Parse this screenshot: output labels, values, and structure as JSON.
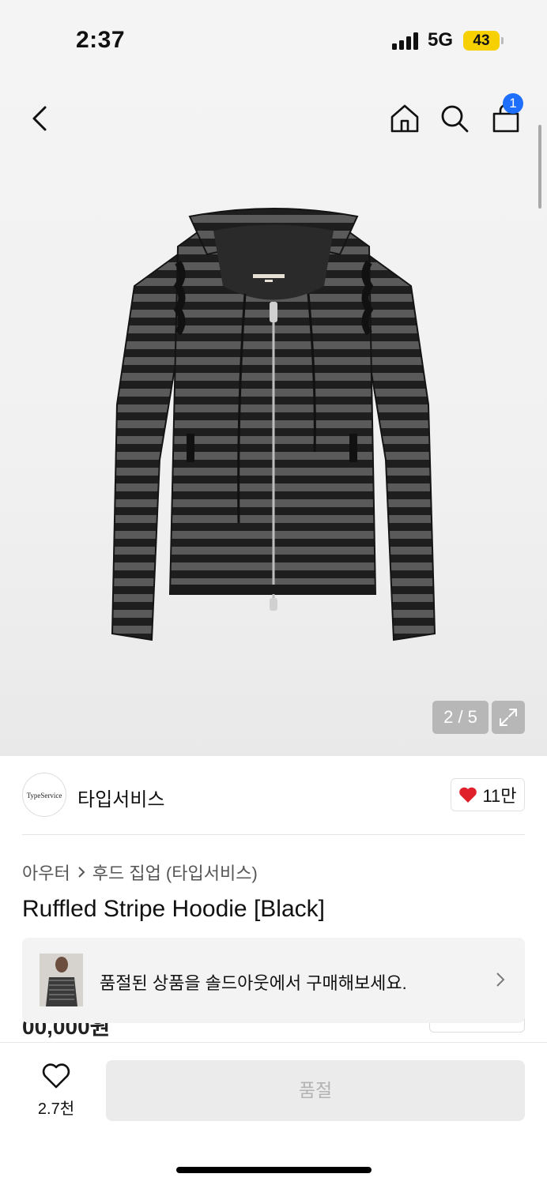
{
  "status_bar": {
    "time": "2:37",
    "network": "5G",
    "battery": "43"
  },
  "nav": {
    "icons": [
      "back-icon",
      "home-icon",
      "search-icon",
      "bag-icon"
    ],
    "cart_count": "1"
  },
  "gallery": {
    "counter": "2 / 5"
  },
  "brand": {
    "logo_text": "TypeService",
    "name": "타입서비스",
    "like_count": "11만"
  },
  "breadcrumb": {
    "category": "아우터",
    "subcategory": "후드 집업 (타입서비스)"
  },
  "product": {
    "title": "Ruffled Stripe Hoodie [Black]",
    "price_partial": "00,000원"
  },
  "soldout_banner": {
    "text": "품절된 상품을 솔드아웃에서 구매해보세요."
  },
  "bottom_bar": {
    "wish_count": "2.7천",
    "buy_label": "품절"
  },
  "colors": {
    "accent_blue": "#1f6fff",
    "heart_red": "#e0202a",
    "battery_yellow": "#f6d000"
  }
}
